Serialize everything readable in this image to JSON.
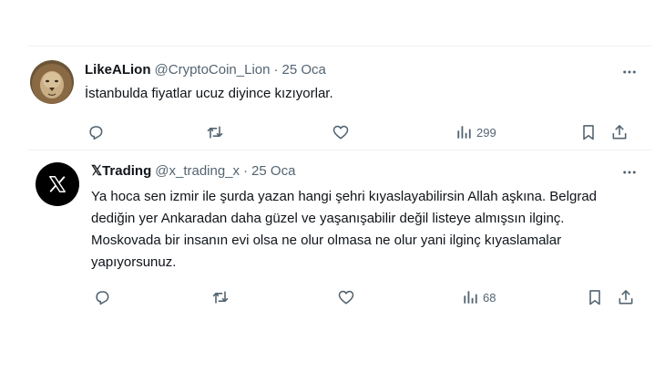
{
  "colors": {
    "text_primary": "#0f1419",
    "text_secondary": "#536471",
    "divider": "#eff3f4"
  },
  "tweets": [
    {
      "avatar_icon": "lion-avatar",
      "name": "LikeALion",
      "handle": "@CryptoCoin_Lion",
      "separator": "·",
      "date": "25 Oca",
      "text": "İstanbulda fiyatlar ucuz diyince kızıyorlar.",
      "views": "299",
      "icons": [
        "reply-icon",
        "retweet-icon",
        "like-icon",
        "views-icon",
        "bookmark-icon",
        "share-icon",
        "more-icon"
      ]
    },
    {
      "avatar_icon": "x-logo-avatar",
      "name": "𝕏Trading",
      "handle": "@x_trading_x",
      "separator": "·",
      "date": "25 Oca",
      "text": "Ya hoca sen izmir ile şurda yazan hangi şehri kıyaslayabilirsin Allah aşkına. Belgrad dediğin yer Ankaradan daha güzel ve yaşanışabilir değil listeye almışsın ilginç. Moskovada bir insanın evi olsa ne olur olmasa ne olur yani ilginç kıyaslamalar yapıyorsunuz.",
      "views": "68",
      "icons": [
        "reply-icon",
        "retweet-icon",
        "like-icon",
        "views-icon",
        "bookmark-icon",
        "share-icon",
        "more-icon"
      ]
    }
  ]
}
